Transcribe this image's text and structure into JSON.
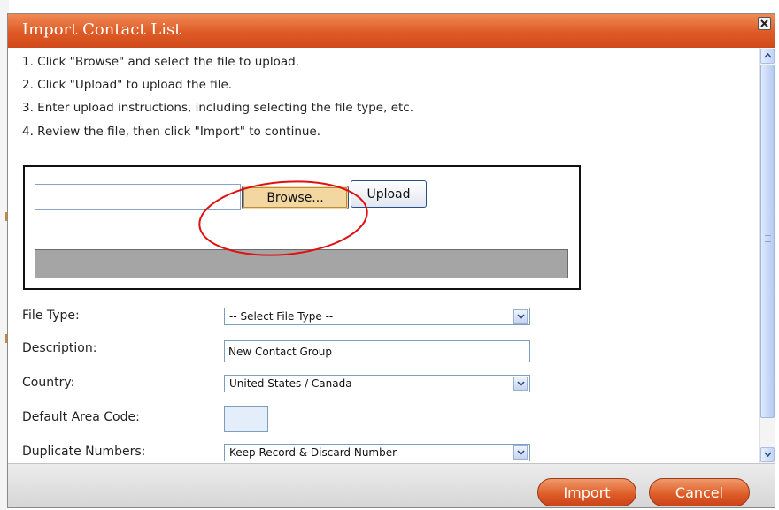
{
  "dialog": {
    "title": "Import Contact List"
  },
  "instructions": [
    "1. Click \"Browse\" and select the file to upload.",
    "2. Click \"Upload\" to upload the file.",
    "3. Enter upload instructions, including selecting the file type, etc.",
    "4. Review the file, then click \"Import\" to continue."
  ],
  "upload": {
    "file_value": "",
    "browse_label": "Browse...",
    "upload_label": "Upload"
  },
  "form": {
    "file_type": {
      "label": "File Type:",
      "value": "-- Select File Type --"
    },
    "description": {
      "label": "Description:",
      "value": "New Contact Group"
    },
    "country": {
      "label": "Country:",
      "value": "United States / Canada"
    },
    "area_code": {
      "label": "Default Area Code:",
      "value": ""
    },
    "duplicates": {
      "label": "Duplicate Numbers:",
      "value": "Keep Record & Discard Number"
    }
  },
  "footer": {
    "import_label": "Import",
    "cancel_label": "Cancel"
  },
  "colors": {
    "title_bar": "#de5a25",
    "annotation": "#e01010",
    "progress": "#a5a5a5"
  },
  "icons": [
    "close-icon",
    "chevron-down-icon",
    "scroll-up-icon",
    "scroll-down-icon"
  ]
}
